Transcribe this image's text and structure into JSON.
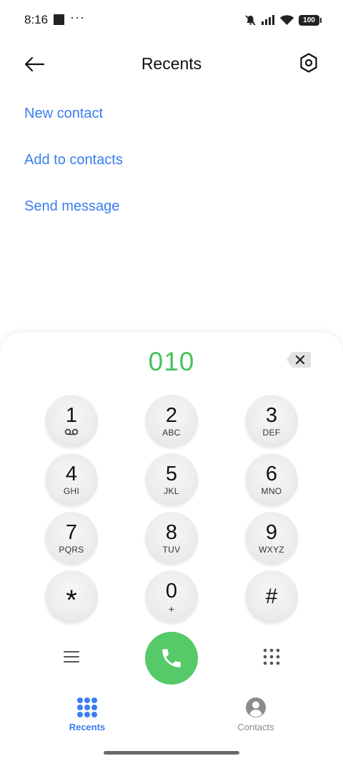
{
  "status_bar": {
    "time": "8:16",
    "dots": "···",
    "battery": "100"
  },
  "app_bar": {
    "title": "Recents"
  },
  "actions": [
    {
      "label": "New contact"
    },
    {
      "label": "Add to contacts"
    },
    {
      "label": "Send message"
    }
  ],
  "dialer": {
    "number": "010",
    "keys": [
      {
        "digit": "1",
        "letters": ""
      },
      {
        "digit": "2",
        "letters": "ABC"
      },
      {
        "digit": "3",
        "letters": "DEF"
      },
      {
        "digit": "4",
        "letters": "GHI"
      },
      {
        "digit": "5",
        "letters": "JKL"
      },
      {
        "digit": "6",
        "letters": "MNO"
      },
      {
        "digit": "7",
        "letters": "PQRS"
      },
      {
        "digit": "8",
        "letters": "TUV"
      },
      {
        "digit": "9",
        "letters": "WXYZ"
      },
      {
        "digit": "*",
        "letters": ""
      },
      {
        "digit": "0",
        "letters": "+"
      },
      {
        "digit": "#",
        "letters": ""
      }
    ]
  },
  "bottom_nav": {
    "recents": "Recents",
    "contacts": "Contacts"
  },
  "colors": {
    "accent": "#3a7ef0",
    "call_green": "#56c968",
    "number_green": "#46c35a"
  },
  "icons": {
    "back": "arrow-left-icon",
    "settings": "hexagon-gear-icon",
    "backspace": "backspace-icon",
    "voicemail": "voicemail-icon",
    "menu": "hamburger-menu-icon",
    "call": "phone-icon",
    "keypad": "dialpad-icon",
    "recents": "dots-grid-icon",
    "contacts": "person-circle-icon"
  }
}
